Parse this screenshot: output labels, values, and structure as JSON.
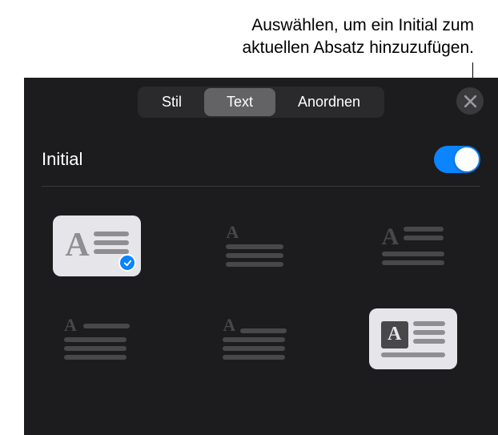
{
  "callout": {
    "line1": "Auswählen, um ein Initial zum",
    "line2": "aktuellen Absatz hinzuzufügen."
  },
  "tabs": {
    "style": "Stil",
    "text": "Text",
    "arrange": "Anordnen"
  },
  "section": {
    "title": "Initial",
    "toggle_on": true
  },
  "options": [
    {
      "id": "raised-large",
      "selected": true
    },
    {
      "id": "raised-small",
      "selected": false
    },
    {
      "id": "dropped-2line",
      "selected": false
    },
    {
      "id": "margin",
      "selected": false
    },
    {
      "id": "centered-above",
      "selected": false
    },
    {
      "id": "boxed",
      "selected": false
    }
  ]
}
